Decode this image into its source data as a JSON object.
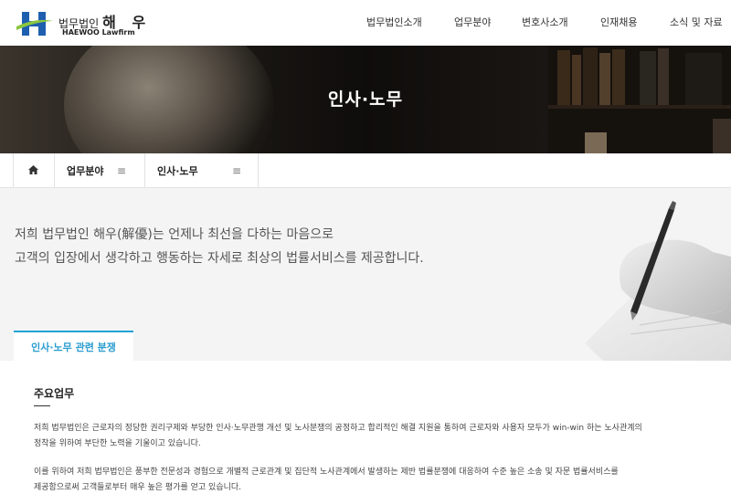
{
  "header": {
    "logo_kr": "법무법인",
    "logo_kr_name": "해 우",
    "logo_en": "HAEWOO Lawfirm",
    "nav": [
      "법무법인소개",
      "업무분야",
      "변호사소개",
      "인재채용",
      "소식 및 자료"
    ]
  },
  "banner": {
    "title": "인사·노무"
  },
  "breadcrumb": {
    "home_icon": "home-icon",
    "level1": "업무분야",
    "level2": "인사·노무",
    "menu_icon": "≡"
  },
  "intro": {
    "line1": "저희 법무법인 해우(解優)는 언제나 최선을 다하는 마음으로",
    "line2": "고객의 입장에서 생각하고 행동하는 자세로 최상의 법률서비스를 제공합니다."
  },
  "tab": {
    "label": "인사·노무 관련 분쟁"
  },
  "content": {
    "section_title": "주요업무",
    "para1_line1": "저희 법무법인은 근로자의 정당한 권리구제와 부당한 인사·노무관행 개선 및 노사분쟁의 공정하고 합리적인 해결 지원을 통하여 근로자와 사용자 모두가 win-win 하는 노사관계의",
    "para1_line2": "정착을 위하여 부단한 노력을 기울이고 있습니다.",
    "para2_line1": "이를 위하여 저희 법무법인은 풍부한 전문성과 경험으로 개별적 근로관계 및 집단적 노사관계에서 발생하는 제반 법률분쟁에 대응하여 수준 높은 소송 및 자문 법률서비스를",
    "para2_line2": "제공함으로써 고객들로부터 매우 높은 평가를 얻고 있습니다."
  },
  "colors": {
    "accent": "#21a3d8",
    "logo_blue": "#1f5fb0",
    "logo_green": "#8cc63f"
  }
}
